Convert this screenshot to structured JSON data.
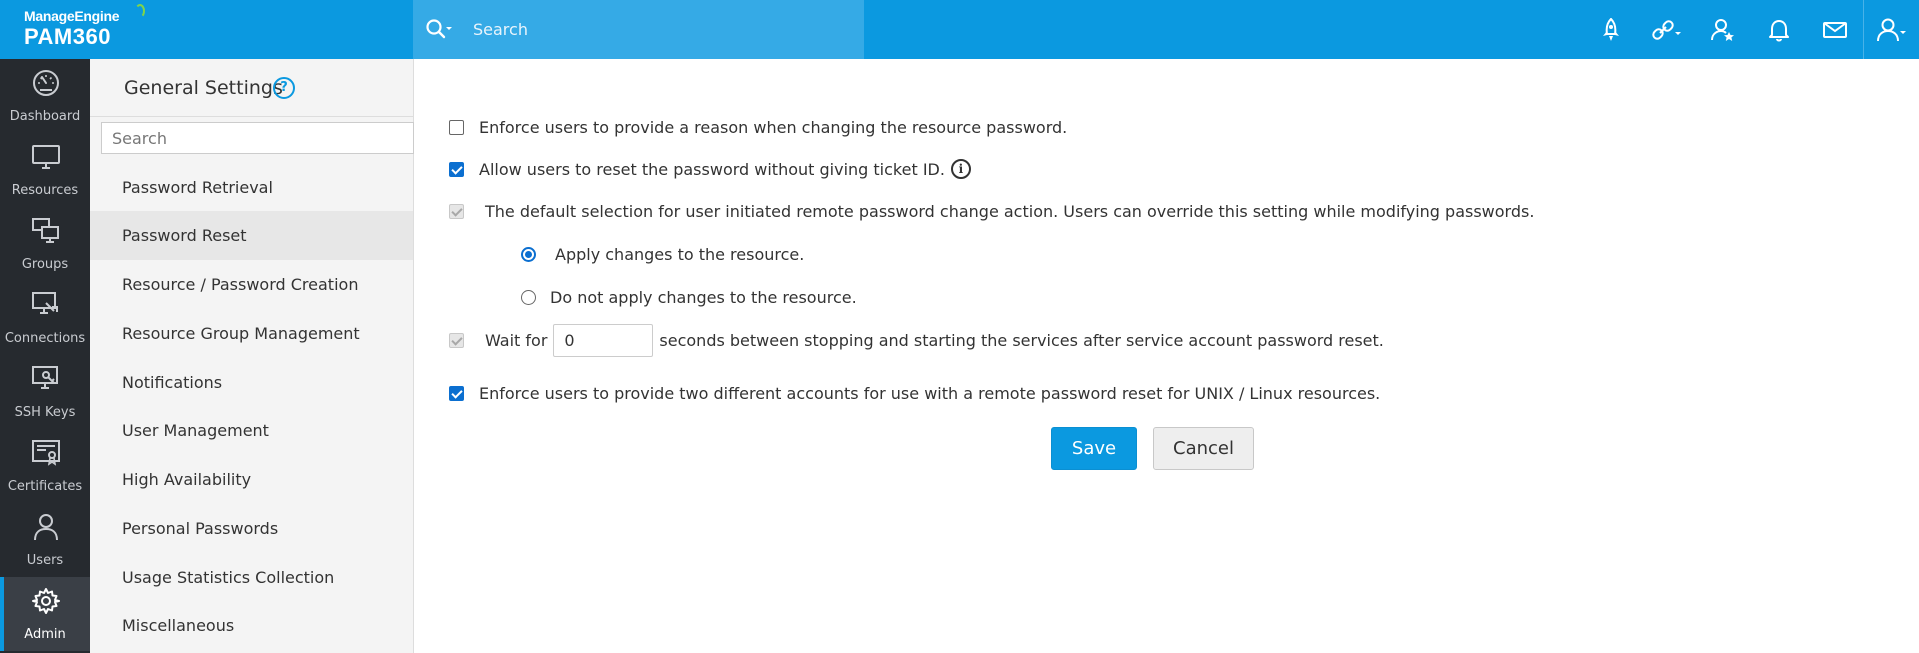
{
  "header": {
    "brand": "ManageEngine",
    "product": "PAM360",
    "search_placeholder": "Search",
    "icons": [
      "rocket-icon",
      "link-dropdown-icon",
      "user-star-icon",
      "bell-icon",
      "mail-icon",
      "user-dropdown-icon"
    ]
  },
  "leftnav": {
    "items": [
      {
        "label": "Dashboard",
        "icon": "dashboard-icon"
      },
      {
        "label": "Resources",
        "icon": "monitor-icon"
      },
      {
        "label": "Groups",
        "icon": "groups-icon"
      },
      {
        "label": "Connections",
        "icon": "connections-icon"
      },
      {
        "label": "SSH Keys",
        "icon": "ssh-keys-icon"
      },
      {
        "label": "Certificates",
        "icon": "certificates-icon"
      },
      {
        "label": "Users",
        "icon": "user-icon"
      },
      {
        "label": "Admin",
        "icon": "gear-icon"
      }
    ],
    "active": "Admin"
  },
  "settings": {
    "title": "General Settings",
    "help": "?",
    "search_placeholder": "Search",
    "items": [
      {
        "label": "Password Retrieval"
      },
      {
        "label": "Password Reset"
      },
      {
        "label": "Resource / Password Creation"
      },
      {
        "label": "Resource Group Management"
      },
      {
        "label": "Notifications"
      },
      {
        "label": "User Management"
      },
      {
        "label": "High Availability"
      },
      {
        "label": "Personal Passwords"
      },
      {
        "label": "Usage Statistics Collection"
      },
      {
        "label": "Miscellaneous"
      }
    ],
    "active": "Password Reset"
  },
  "content": {
    "opt_reason": {
      "label": "Enforce users to provide a reason when changing the resource password.",
      "checked": false
    },
    "opt_ticket": {
      "label": "Allow users to reset the password without giving ticket ID.",
      "checked": true,
      "info": "i"
    },
    "opt_default": {
      "label": "The default selection for user initiated remote password change action. Users can override this setting while modifying passwords.",
      "checked": true,
      "disabled": true
    },
    "radio_apply": {
      "label": "Apply changes to the resource.",
      "selected": true
    },
    "radio_not_apply": {
      "label": "Do not apply changes to the resource.",
      "selected": false
    },
    "opt_wait": {
      "prefix": "Wait for",
      "value": "0",
      "suffix": "seconds between stopping and starting the services after service account password reset.",
      "checked": true,
      "disabled": true
    },
    "opt_two_accounts": {
      "label": "Enforce users to provide two different accounts for use with a remote password reset for UNIX / Linux resources.",
      "checked": true
    },
    "save_label": "Save",
    "cancel_label": "Cancel"
  },
  "colors": {
    "header_bg": "#0b99e0",
    "search_bg": "#35aae6",
    "nav_bg": "#262a2f",
    "accent": "#0b99e0",
    "checkbox": "#0b6fd0"
  }
}
